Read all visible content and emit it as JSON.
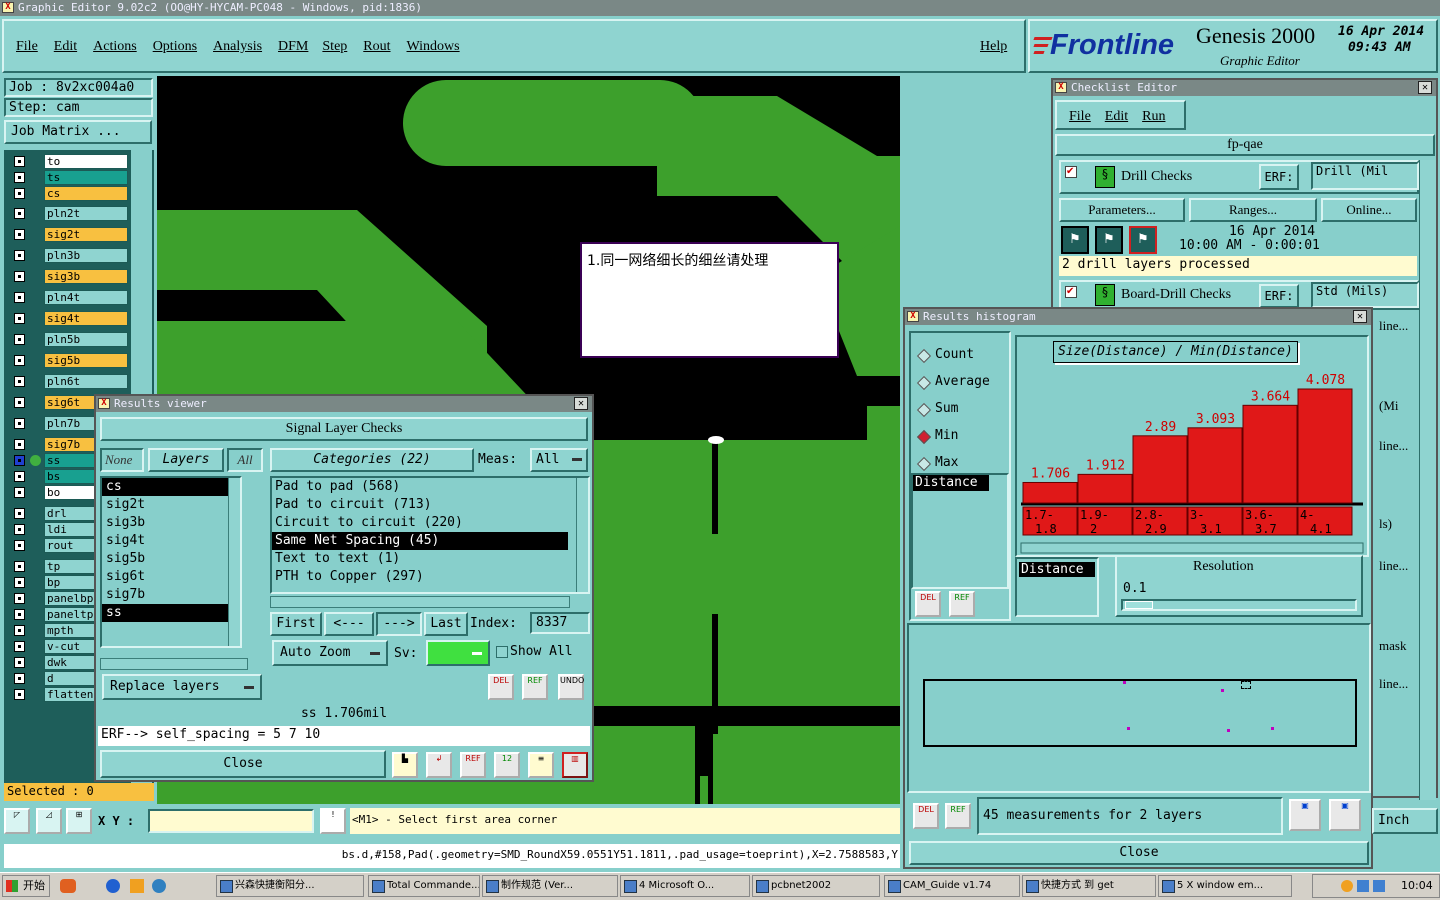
{
  "app": {
    "window_title": "Graphic Editor 9.02c2  (OO@HY-HYCAM-PC048 - Windows, pid:1836)",
    "menu": [
      "File",
      "Edit",
      "Actions",
      "Options",
      "Analysis",
      "DFM",
      "Step",
      "Rout",
      "Windows"
    ],
    "help": "Help",
    "brand": "Frontline",
    "product": "Genesis 2000",
    "product_sub": "Graphic Editor",
    "date": "16 Apr 2014",
    "time": "09:43 AM"
  },
  "left": {
    "job": "Job : 8v2xc004a0",
    "step": "Step: cam",
    "job_matrix": "Job Matrix ...",
    "layers": [
      {
        "name": "to",
        "color": "#ffffff"
      },
      {
        "name": "ts",
        "color": "#18a090"
      },
      {
        "name": "cs",
        "color": "#f8c040"
      },
      {
        "name": "pln2t",
        "color": "#8fd4d0"
      },
      {
        "name": "sig2t",
        "color": "#f8c040"
      },
      {
        "name": "pln3b",
        "color": "#8fd4d0"
      },
      {
        "name": "sig3b",
        "color": "#f8c040"
      },
      {
        "name": "pln4t",
        "color": "#8fd4d0"
      },
      {
        "name": "sig4t",
        "color": "#f8c040"
      },
      {
        "name": "pln5b",
        "color": "#8fd4d0"
      },
      {
        "name": "sig5b",
        "color": "#f8c040"
      },
      {
        "name": "pln6t",
        "color": "#8fd4d0"
      },
      {
        "name": "sig6t",
        "color": "#f8c040"
      },
      {
        "name": "pln7b",
        "color": "#8fd4d0"
      },
      {
        "name": "sig7b",
        "color": "#f8c040"
      },
      {
        "name": "ss",
        "color": "#18a090"
      },
      {
        "name": "bs",
        "color": "#18a090"
      },
      {
        "name": "bo",
        "color": "#ffffff"
      },
      {
        "name": "drl",
        "color": "#8fd4d0"
      },
      {
        "name": "ldi",
        "color": "#8fd4d0"
      },
      {
        "name": "rout",
        "color": "#8fd4d0"
      },
      {
        "name": "tp",
        "color": "#8fd4d0"
      },
      {
        "name": "bp",
        "color": "#8fd4d0"
      },
      {
        "name": "panelbp",
        "color": "#8fd4d0"
      },
      {
        "name": "paneltp",
        "color": "#8fd4d0"
      },
      {
        "name": "mpth",
        "color": "#8fd4d0"
      },
      {
        "name": "v-cut",
        "color": "#8fd4d0"
      },
      {
        "name": "dwk",
        "color": "#8fd4d0"
      },
      {
        "name": "d",
        "color": "#8fd4d0"
      },
      {
        "name": "flatten",
        "color": "#8fd4d0"
      }
    ],
    "selected": "Selected : 0"
  },
  "canvas": {
    "note": "1.同一网络细长的细丝请处理"
  },
  "results_viewer": {
    "title": "Results viewer",
    "heading": "Signal Layer Checks",
    "none": "None",
    "layers": "Layers",
    "all": "All",
    "categories": "Categories (22)",
    "meas_label": "Meas:",
    "meas_value": "All",
    "layer_list": [
      "cs",
      "sig2t",
      "sig3b",
      "sig4t",
      "sig5b",
      "sig6t",
      "sig7b",
      "ss"
    ],
    "category_list": [
      "Pad to pad (568)",
      "Pad to circuit (713)",
      "Circuit to circuit (220)",
      "Same Net Spacing (45)",
      "Text to text (1)",
      "PTH to Copper (297)"
    ],
    "first": "First",
    "prev": "<---",
    "next": "--->",
    "last": "Last",
    "index_label": "Index:",
    "index_value": "8337",
    "auto_zoom": "Auto Zoom",
    "sv": "Sv:",
    "show_all": "Show All",
    "replace_layers": "Replace layers",
    "measure": "ss 1.706mil",
    "erf": "ERF--> self_spacing = 5 7 10",
    "close": "Close"
  },
  "checklist": {
    "title": "Checklist Editor",
    "menu": [
      "File",
      "Edit",
      "Run"
    ],
    "name": "fp-qae",
    "drill_checks": "Drill Checks",
    "erf": "ERF:",
    "drill_erf": "Drill (Mil",
    "parameters": "Parameters...",
    "ranges": "Ranges...",
    "online": "Online...",
    "run_date": "16 Apr 2014",
    "run_time": "10:00 AM - 0:00:01",
    "processed": "2 drill layers processed",
    "board_drill": "Board-Drill Checks",
    "board_erf": "Std (Mils)",
    "side_labels": [
      "line...",
      "(Mi",
      "line...",
      "ls)",
      "line...",
      "mask",
      "line..."
    ]
  },
  "histogram": {
    "title": "Results histogram",
    "modes": [
      "Count",
      "Average",
      "Sum",
      "Min",
      "Max"
    ],
    "selected_mode": "Min",
    "attr": "Distance",
    "chart_title": "Size(Distance) / Min(Distance)",
    "resolution_label": "Resolution",
    "resolution_value": "0.1",
    "sort_label": "Distance",
    "summary": "45 measurements for 2 layers",
    "close": "Close",
    "del": "DEL",
    "ref": "REF"
  },
  "chart_data": {
    "type": "bar",
    "title": "Size(Distance) / Min(Distance)",
    "categories": [
      "1.7-1.8",
      "1.9-2",
      "2.8-2.9",
      "3-3.1",
      "3.6-3.7",
      "4-4.1"
    ],
    "values": [
      1.706,
      1.912,
      2.89,
      3.093,
      3.664,
      4.078
    ],
    "ylim": [
      0,
      4.3
    ]
  },
  "bottom": {
    "xy_label": "X Y :",
    "xy_value": "",
    "prompt": "<M1> - Select first area corner",
    "units": "Inch",
    "status": "bs.d,#158,Pad(.geometry=SMD_RoundX59.0551Y51.1811,.pad_usage=toeprint),X=2.7588583,Y"
  },
  "taskbar": {
    "start": "开始",
    "items": [
      "兴森快捷衡阳分...",
      "Total Commande...",
      "制作规范 (Ver...",
      "4 Microsoft O...",
      "pcbnet2002",
      "CAM_Guide v1.74",
      "快捷方式 到 get",
      "5 X window em..."
    ],
    "clock": "10:04"
  }
}
